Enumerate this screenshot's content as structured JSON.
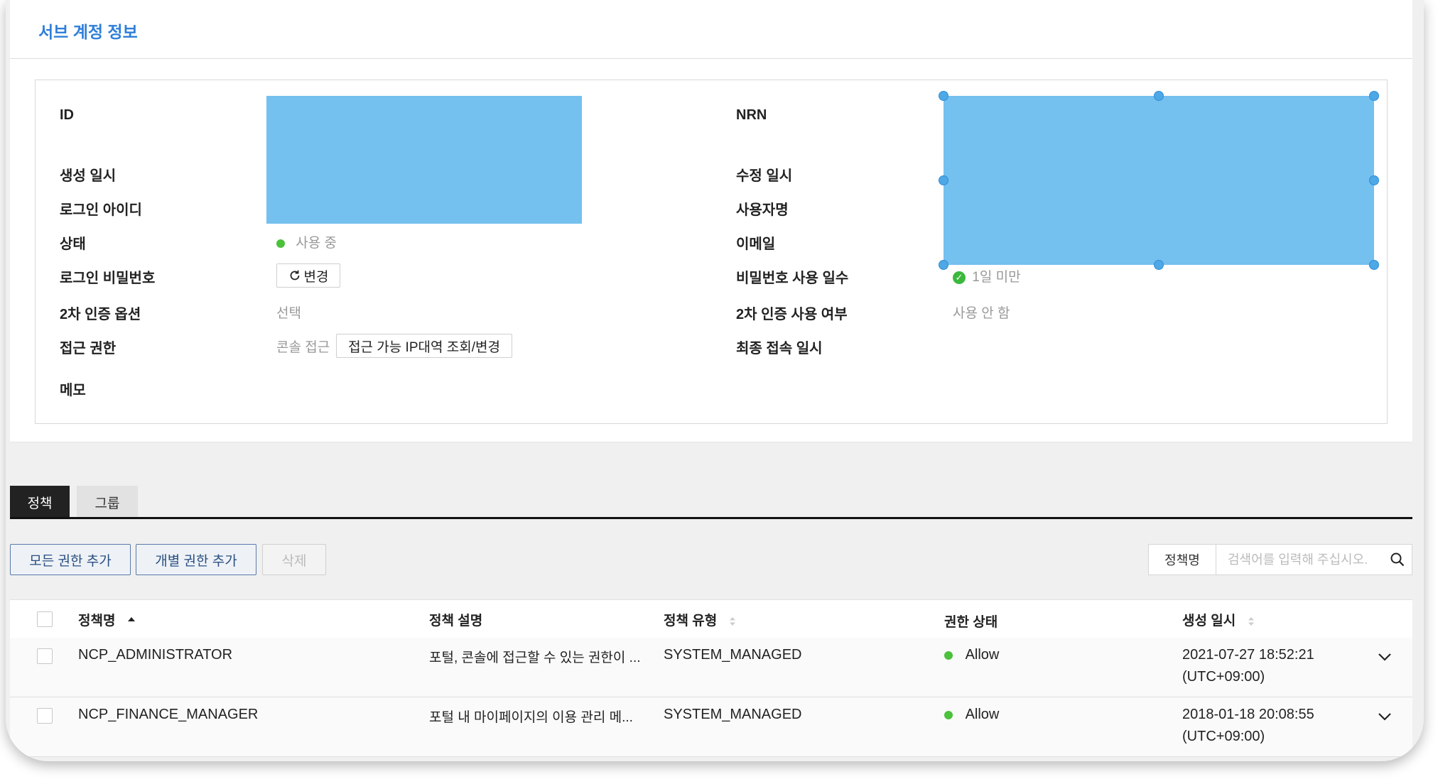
{
  "card": {
    "title": "서브 계정 정보",
    "left_labels": {
      "id": "ID",
      "created": "생성 일시",
      "login_id": "로그인 아이디",
      "status": "상태",
      "login_password": "로그인 비밀번호",
      "mfa_option": "2차 인증 옵션",
      "access": "접근 권한",
      "memo": "메모"
    },
    "right_labels": {
      "nrn": "NRN",
      "modified": "수정 일시",
      "username": "사용자명",
      "email": "이메일",
      "password_days": "비밀번호 사용 일수",
      "mfa_used": "2차 인증 사용 여부",
      "last_access": "최종 접속 일시"
    },
    "values": {
      "status": "사용 중",
      "change_button": "변경",
      "mfa_option": "선택",
      "access_type": "콘솔 접근",
      "ip_button": "접근 가능 IP대역 조회/변경",
      "password_days": "1일 미만",
      "mfa_used": "사용 안 함"
    },
    "status_color": "#4cc13c",
    "mask_color": "#74c0ef"
  },
  "tabs": [
    {
      "label": "정책",
      "active": true
    },
    {
      "label": "그룹",
      "active": false
    }
  ],
  "actions": {
    "add_all": "모든 권한 추가",
    "add_individual": "개별 권한 추가",
    "delete": "삭제"
  },
  "search": {
    "category": "정책명",
    "placeholder": "검색어를 입력해 주십시오."
  },
  "table": {
    "headers": {
      "name": "정책명",
      "description": "정책 설명",
      "type": "정책 유형",
      "status": "권한 상태",
      "created": "생성 일시"
    },
    "rows": [
      {
        "name": "NCP_ADMINISTRATOR",
        "description": "포털, 콘솔에 접근할 수 있는 권한이 ...",
        "type": "SYSTEM_MANAGED",
        "status": "Allow",
        "created_date": "2021-07-27 18:52:21",
        "created_tz": "(UTC+09:00)"
      },
      {
        "name": "NCP_FINANCE_MANAGER",
        "description": "포털 내 마이페이지의 이용 관리 메...",
        "type": "SYSTEM_MANAGED",
        "status": "Allow",
        "created_date": "2018-01-18 20:08:55",
        "created_tz": "(UTC+09:00)"
      }
    ]
  }
}
